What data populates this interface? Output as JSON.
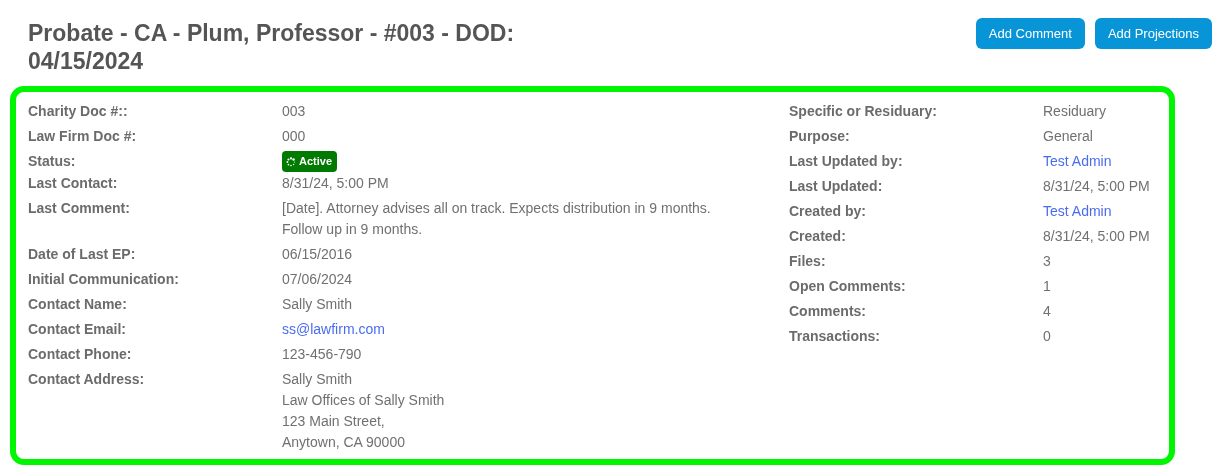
{
  "title": "Probate - CA - Plum, Professor - #003 - DOD: 04/15/2024",
  "buttons": [
    "Add Comment",
    "Add Projections"
  ],
  "left_fields": [
    {
      "label": "Charity Doc #::",
      "kind": "text",
      "value": "003"
    },
    {
      "label": "Law Firm Doc #:",
      "kind": "text",
      "value": "000"
    },
    {
      "label": "Status:",
      "kind": "badge",
      "value": "Active"
    },
    {
      "label": "Last Contact:",
      "kind": "text",
      "value": "8/31/24, 5:00 PM"
    },
    {
      "label": "Last Comment:",
      "kind": "text",
      "value": "[Date]. Attorney advises all on track. Expects distribution in 9 months. Follow up in 9 months."
    },
    {
      "label": "Date of Last EP:",
      "kind": "text",
      "value": "06/15/2016"
    },
    {
      "label": "Initial Communication:",
      "kind": "text",
      "value": "07/06/2024"
    },
    {
      "label": "Contact Name:",
      "kind": "text",
      "value": "Sally Smith"
    },
    {
      "label": "Contact Email:",
      "kind": "link",
      "value": "ss@lawfirm.com"
    },
    {
      "label": "Contact Phone:",
      "kind": "text",
      "value": "123-456-790"
    },
    {
      "label": "Contact Address:",
      "kind": "lines",
      "lines": [
        "Sally Smith",
        "Law Offices of Sally Smith",
        "123 Main Street,",
        "Anytown, CA 90000"
      ]
    }
  ],
  "right_fields": [
    {
      "label": "Specific or Residuary:",
      "kind": "text",
      "value": "Residuary"
    },
    {
      "label": "Purpose:",
      "kind": "text",
      "value": "General"
    },
    {
      "label": "Last Updated by:",
      "kind": "link",
      "value": "Test Admin"
    },
    {
      "label": "Last Updated:",
      "kind": "text",
      "value": "8/31/24, 5:00 PM"
    },
    {
      "label": "Created by:",
      "kind": "link",
      "value": "Test Admin"
    },
    {
      "label": "Created:",
      "kind": "text",
      "value": "8/31/24, 5:00 PM"
    },
    {
      "label": "Files:",
      "kind": "text",
      "value": "3"
    },
    {
      "label": "Open Comments:",
      "kind": "text",
      "value": "1"
    },
    {
      "label": "Comments:",
      "kind": "text",
      "value": "4"
    },
    {
      "label": "Transactions:",
      "kind": "text",
      "value": "0"
    }
  ]
}
